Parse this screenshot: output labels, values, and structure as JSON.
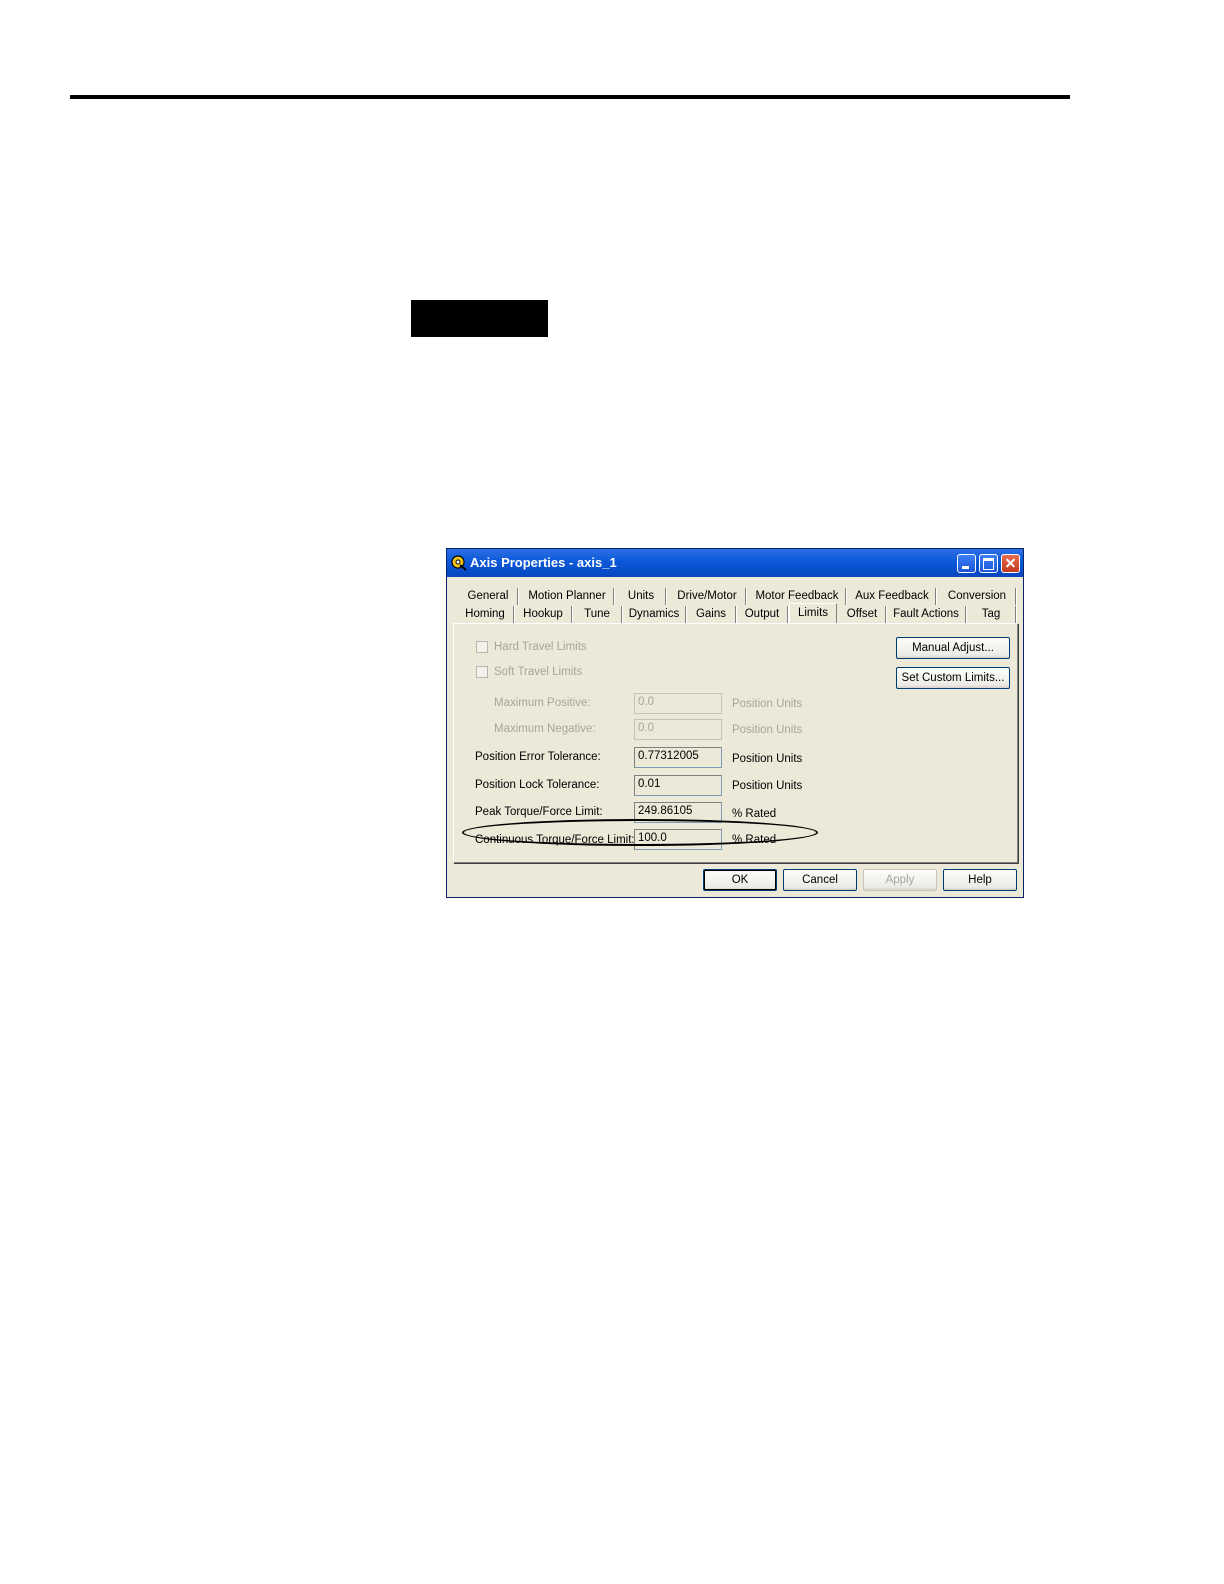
{
  "window": {
    "title": "Axis Properties - axis_1"
  },
  "tabs": {
    "row1": [
      {
        "label": "General"
      },
      {
        "label": "Motion Planner"
      },
      {
        "label": "Units"
      },
      {
        "label": "Drive/Motor"
      },
      {
        "label": "Motor Feedback"
      },
      {
        "label": "Aux Feedback"
      },
      {
        "label": "Conversion"
      }
    ],
    "row2": [
      {
        "label": "Homing"
      },
      {
        "label": "Hookup"
      },
      {
        "label": "Tune"
      },
      {
        "label": "Dynamics"
      },
      {
        "label": "Gains"
      },
      {
        "label": "Output"
      },
      {
        "label": "Limits"
      },
      {
        "label": "Offset"
      },
      {
        "label": "Fault Actions"
      },
      {
        "label": "Tag"
      }
    ],
    "active": "Limits"
  },
  "limits": {
    "hard_travel_limits": "Hard Travel Limits",
    "soft_travel_limits": "Soft Travel Limits",
    "manual_adjust_button": "Manual Adjust...",
    "set_custom_limits_button": "Set Custom Limits...",
    "fields": [
      {
        "label": "Maximum Positive:",
        "value": "0.0",
        "unit": "Position Units",
        "enabled": false
      },
      {
        "label": "Maximum Negative:",
        "value": "0.0",
        "unit": "Position Units",
        "enabled": false
      },
      {
        "label": "Position Error Tolerance:",
        "value": "0.77312005",
        "unit": "Position Units",
        "enabled": true
      },
      {
        "label": "Position Lock Tolerance:",
        "value": "0.01",
        "unit": "Position Units",
        "enabled": true
      },
      {
        "label": "Peak Torque/Force Limit:",
        "value": "249.86105",
        "unit": "% Rated",
        "enabled": true
      },
      {
        "label": "Continuous Torque/Force Limit:",
        "value": "100.0",
        "unit": "% Rated",
        "enabled": true
      }
    ]
  },
  "buttons": {
    "ok": "OK",
    "cancel": "Cancel",
    "apply": "Apply",
    "help": "Help"
  }
}
